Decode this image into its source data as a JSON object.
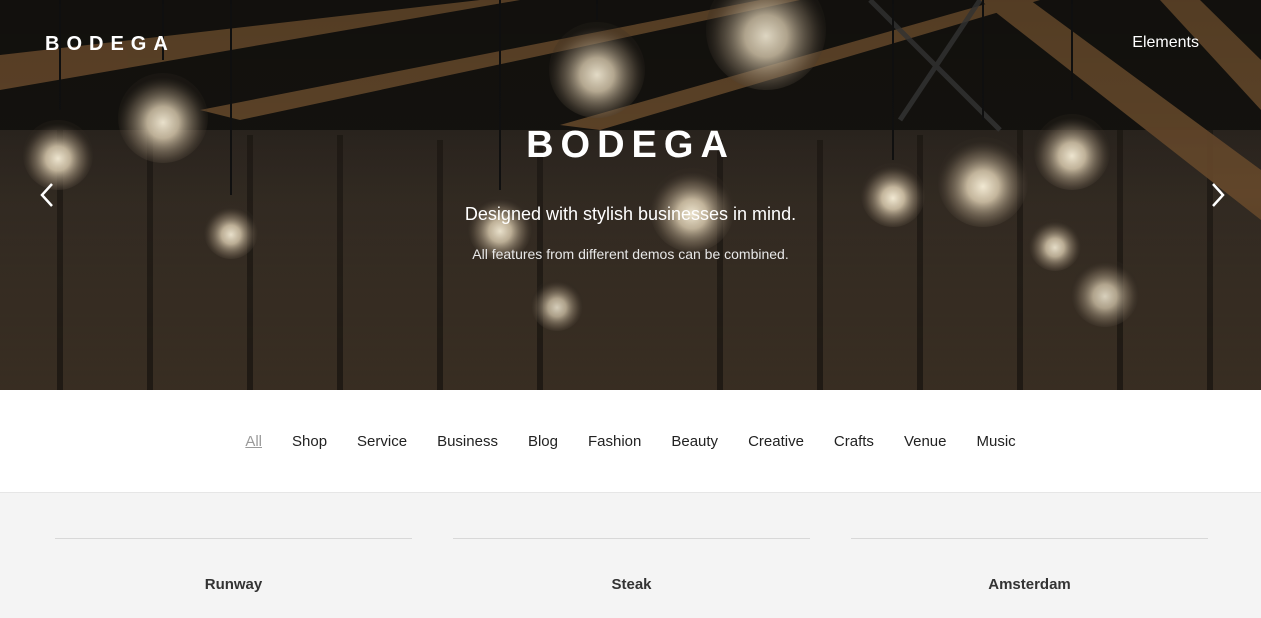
{
  "header": {
    "logo": "BODEGA",
    "nav_link": "Elements"
  },
  "hero": {
    "title": "BODEGA",
    "subtitle": "Designed with stylish businesses in mind.",
    "tagline": "All features from different demos can be combined.",
    "prev_icon": "chevron-left-icon",
    "next_icon": "chevron-right-icon"
  },
  "filters": {
    "active": "All",
    "items": [
      "All",
      "Shop",
      "Service",
      "Business",
      "Blog",
      "Fashion",
      "Beauty",
      "Creative",
      "Crafts",
      "Venue",
      "Music"
    ]
  },
  "cards": [
    {
      "title": "Runway"
    },
    {
      "title": "Steak"
    },
    {
      "title": "Amsterdam"
    }
  ],
  "colors": {
    "filter_active": "#9a9a9a",
    "text_dark": "#222222",
    "page_bg": "#f4f4f4"
  }
}
